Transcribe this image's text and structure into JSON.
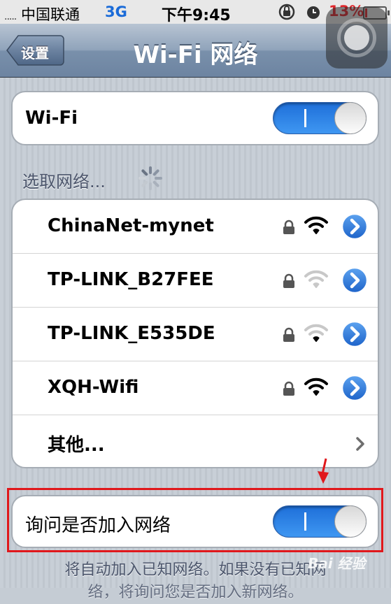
{
  "status_bar": {
    "signal_dots": ".....",
    "carrier": "中国联通",
    "network": "3G",
    "time": "下午9:45",
    "battery_percent": "13%",
    "battery_level": 0.13,
    "icons": [
      "rotation-lock-icon",
      "alarm-icon"
    ]
  },
  "nav": {
    "back_label": "设置",
    "title": "Wi-Fi 网络"
  },
  "wifi_toggle": {
    "label": "Wi-Fi",
    "on_mark": "I",
    "state": "on"
  },
  "networks_section": {
    "label": "选取网络..."
  },
  "networks": [
    {
      "name": "ChinaNet-mynet",
      "locked": true,
      "signal": 3
    },
    {
      "name": "TP-LINK_B27FEE",
      "locked": true,
      "signal": 0
    },
    {
      "name": "TP-LINK_E535DE",
      "locked": true,
      "signal": 1
    },
    {
      "name": "XQH-Wifi",
      "locked": true,
      "signal": 3
    }
  ],
  "other": {
    "label": "其他..."
  },
  "ask_join": {
    "label": "询问是否加入网络",
    "on_mark": "I",
    "state": "on"
  },
  "footer": {
    "line1": "将自动加入已知网络。如果没有已知网",
    "line2": "络，将询问您是否加入新网络。"
  },
  "watermark": "Bai 经验",
  "colors": {
    "toggle_blue": "#2f80e6",
    "highlight_red": "#e0181c",
    "disclosure_blue": "#2a76db"
  }
}
